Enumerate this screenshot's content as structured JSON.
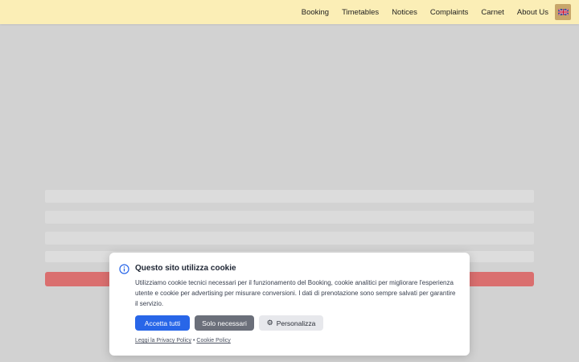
{
  "nav": {
    "items": [
      "Booking",
      "Timetables",
      "Notices",
      "Complaints",
      "Carnet",
      "About Us"
    ],
    "language_icon": "uk-flag-icon"
  },
  "cookie": {
    "title": "Questo sito utilizza cookie",
    "text": "Utilizziamo cookie tecnici necessari per il funzionamento del Booking, cookie analitici per migliorare l'esperienza utente e cookie per advertising per misurare conversioni. I dati di prenotazione sono sempre salvati per garantire il servizio.",
    "accept_label": "Accetta tutti",
    "necessary_label": "Solo necessari",
    "customize_label": "Personalizza",
    "privacy_link": "Leggi la Privacy Policy",
    "separator": "•",
    "cookie_link": "Cookie Policy",
    "info_icon": "info-icon",
    "customize_icon": "gear-icon"
  },
  "colors": {
    "topbar": "#fbeeb6",
    "accept": "#2866e8",
    "necessary": "#6b6f7a",
    "customize": "#e7e8ec",
    "submit": "#e21f1f"
  }
}
